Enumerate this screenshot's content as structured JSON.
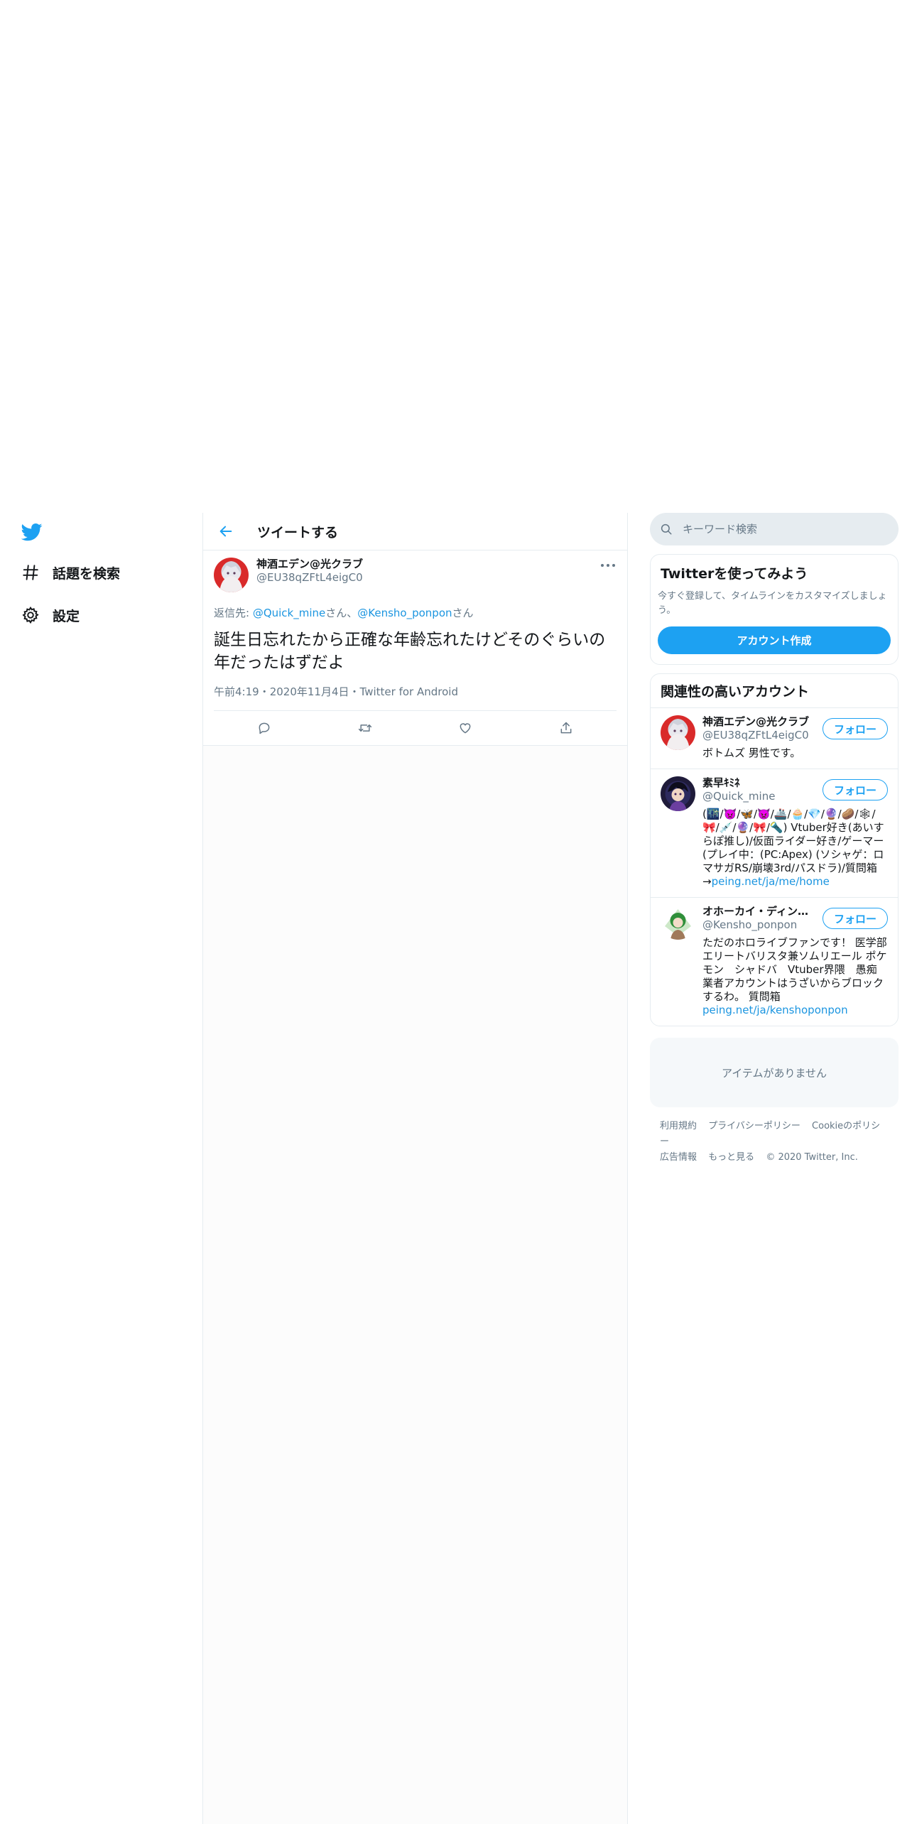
{
  "nav": {
    "explore_label": "話題を検索",
    "settings_label": "設定"
  },
  "header": {
    "title": "ツイートする"
  },
  "tweet": {
    "author_name": "神酒エデン@光クラブ",
    "author_handle": "@EU38qZFtL4eigC0",
    "reply_prefix": "返信先: ",
    "reply_user1": "@Quick_mine",
    "reply_san1": "さん、",
    "reply_user2": "@Kensho_ponpon",
    "reply_san2": "さん",
    "text": "誕生日忘れたから正確な年齢忘れたけどそのぐらいの年だったはずだよ",
    "time": "午前4:19",
    "date": "2020年11月4日",
    "source": "Twitter for Android",
    "sep": "・"
  },
  "search": {
    "placeholder": "キーワード検索"
  },
  "signup": {
    "title": "Twitterを使ってみよう",
    "text": "今すぐ登録して、タイムラインをカスタマイズしましょう。",
    "button": "アカウント作成"
  },
  "related": {
    "title": "関連性の高いアカウント",
    "follow_label": "フォロー",
    "users": [
      {
        "name": "神酒エデン@光クラブ",
        "handle": "@EU38qZFtL4eigC0",
        "bio": "ボトムズ 男性です。",
        "link": ""
      },
      {
        "name": "素早ｷﾐﾈ",
        "handle": "@Quick_mine",
        "bio": "(🌃/👿/🦋/👿/🚢/🧁/💎/🔮/🥔/🕸/🎀/💉/🔮/🎀/🔦) Vtuber好き(あいすらぽ推し)/仮面ライダー好き/ゲーマー(プレイ中：(PC:Apex)  (ソシャゲ：ロマサガRS/崩壊3rd/パスドラ)/質問箱→",
        "link": "peing.net/ja/me/home"
      },
      {
        "name": "オホーカイ・ディン…",
        "handle": "@Kensho_ponpon",
        "bio": "ただのホロライブファンです！ 医学部エリートバリスタ兼ソムリエール ポケモン　シャドバ　Vtuber界隈　愚痴 業者アカウントはうざいからブロックするわ。 質問箱",
        "link": "peing.net/ja/kenshoponpon"
      }
    ]
  },
  "trends_empty": "アイテムがありません",
  "footer": {
    "terms": "利用規約",
    "privacy": "プライバシーポリシー",
    "cookies": "Cookieのポリシー",
    "ads": "広告情報",
    "more": "もっと見る",
    "copyright": "© 2020 Twitter, Inc."
  },
  "colors": {
    "accent": "#1da1f2",
    "link": "#1b95e0",
    "secondary_text": "#657786",
    "border": "#e6ecf0"
  },
  "icons": [
    "twitter-bird-icon",
    "hashtag-icon",
    "gear-icon",
    "back-arrow-icon",
    "more-dots-icon",
    "reply-icon",
    "retweet-icon",
    "like-icon",
    "share-icon",
    "search-icon"
  ]
}
